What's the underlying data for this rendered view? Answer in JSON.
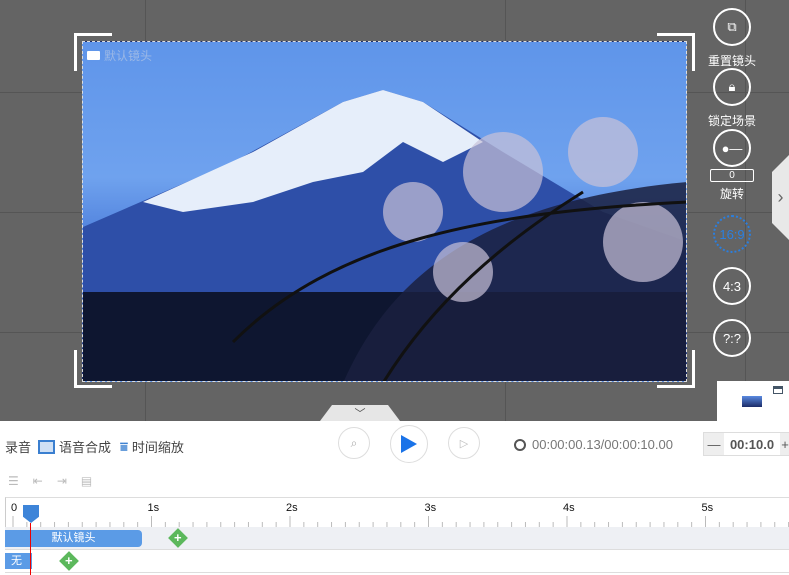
{
  "preview": {
    "camera_label": "默认镜头"
  },
  "side_controls": {
    "reset": "重置镜头",
    "lock": "锁定场景",
    "rotate_label": "旋转",
    "rotate_value": "0",
    "ratio_16_9": "16:9",
    "ratio_4_3": "4:3",
    "ratio_custom": "?:?",
    "active_color": "#2a7fe0"
  },
  "toolbar": {
    "record": "录音",
    "tts": "语音合成",
    "time_scale": "时间缩放",
    "time_display": "00:00:00.13/00:00:10.00",
    "zoom_value": "00:10.0",
    "zoom_minus": "—",
    "zoom_plus": "+"
  },
  "timeline": {
    "ticks": [
      "0",
      "1s",
      "2s",
      "3s",
      "4s",
      "5s"
    ],
    "playhead_seconds": 0.13,
    "track1_clip": "默认镜头",
    "track1_clip_seconds": [
      0,
      1
    ],
    "track2_clip": "无"
  }
}
